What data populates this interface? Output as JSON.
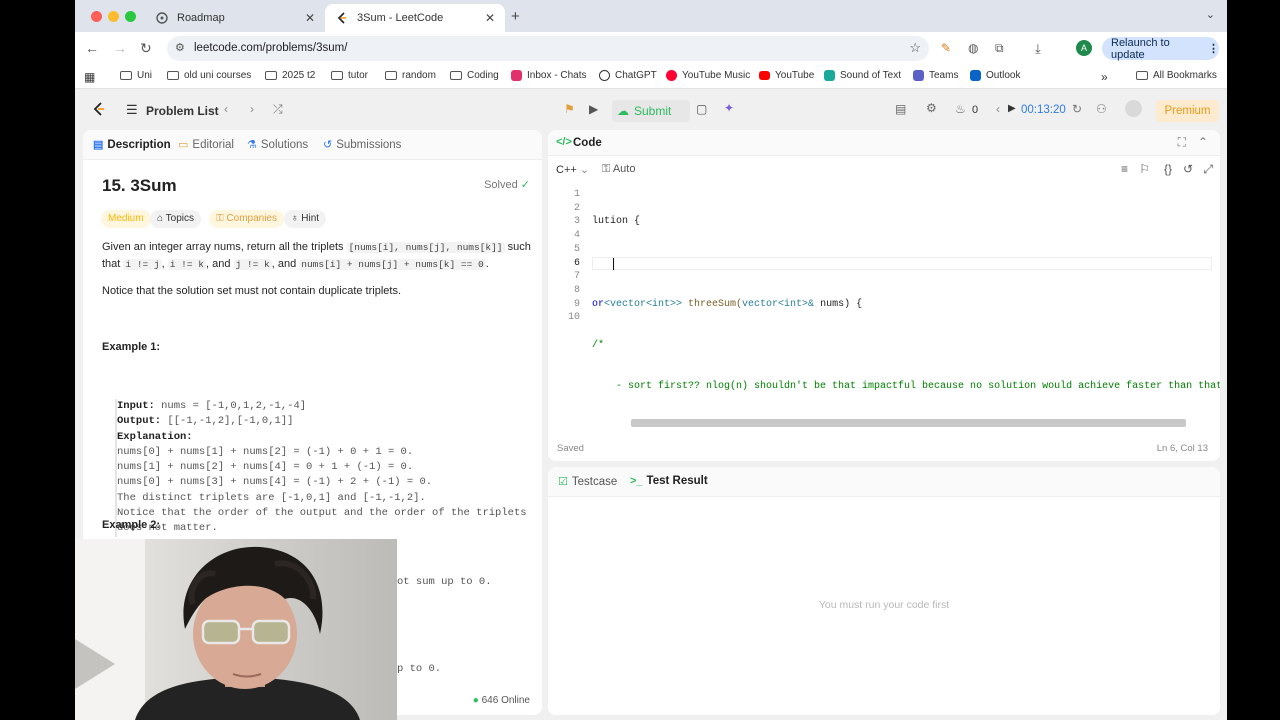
{
  "browser": {
    "tabs": [
      {
        "title": "Roadmap",
        "active": false
      },
      {
        "title": "3Sum - LeetCode",
        "active": true
      }
    ],
    "url": "leetcode.com/problems/3sum/",
    "relaunch_label": "Relaunch to update",
    "avatar_letter": "A",
    "bookmarks": [
      "Uni",
      "old uni courses",
      "2025 t2",
      "tutor",
      "random",
      "Coding",
      "Inbox - Chats",
      "ChatGPT",
      "YouTube Music",
      "YouTube",
      "Sound of Text",
      "Teams",
      "Outlook"
    ],
    "all_bookmarks": "All Bookmarks",
    "overflow": "»"
  },
  "header": {
    "problem_list": "Problem List",
    "submit": "Submit",
    "streak": "0",
    "timer": "00:13:20",
    "premium": "Premium"
  },
  "left": {
    "tabs": [
      "Description",
      "Editorial",
      "Solutions",
      "Submissions"
    ],
    "title": "15. 3Sum",
    "solved": "Solved",
    "chips": {
      "difficulty": "Medium",
      "topics": "Topics",
      "companies": "Companies",
      "hint": "Hint"
    },
    "desc1_a": "Given an integer array nums, return all the triplets",
    "desc1_c1": "[nums[i], nums[j], nums[k]]",
    "desc1_b": "such that",
    "desc1_c2": "i != j",
    "desc1_c3": "i != k",
    "desc1_and": ", and",
    "desc1_c4": "j != k",
    "desc1_and2": ", and",
    "desc1_c5": "nums[i] + nums[j] + nums[k] == 0",
    "desc2": "Notice that the solution set must not contain duplicate triplets.",
    "example1": "Example 1:",
    "ex1": {
      "input_label": "Input:",
      "input": "nums = [-1,0,1,2,-1,-4]",
      "output_label": "Output:",
      "output": "[[-1,-1,2],[-1,0,1]]",
      "explanation_label": "Explanation:",
      "lines": [
        "nums[0] + nums[1] + nums[2] = (-1) + 0 + 1 = 0.",
        "nums[1] + nums[2] + nums[4] = 0 + 1 + (-1) = 0.",
        "nums[0] + nums[3] + nums[4] = (-1) + 2 + (-1) = 0.",
        "The distinct triplets are [-1,0,1] and [-1,-1,2].",
        "Notice that the order of the output and the order of the triplets",
        "does not matter."
      ]
    },
    "example2": "Example 2:",
    "partial1": "ot sum up to 0.",
    "partial2": "p to 0.",
    "online": "646 Online"
  },
  "code": {
    "title": "Code",
    "language": "C++",
    "mode": "Auto",
    "line_numbers": [
      "1",
      "2",
      "3",
      "4",
      "5",
      "6",
      "7",
      "8",
      "9",
      "10"
    ],
    "line1": "lution {",
    "line3_a": "or",
    "line3_b": "<vector<int>>",
    "line3_c": " threeSum(",
    "line3_d": "vector<int>&",
    "line3_e": " nums) {",
    "line4": "/*",
    "line5": "    - sort first?? nlog(n) shouldn't be that impactful because no solution would achieve faster than that anyways",
    "line8": "*/",
    "saved": "Saved",
    "position": "Ln 6, Col 13"
  },
  "bottom": {
    "tabs": [
      "Testcase",
      "Test Result"
    ],
    "empty": "You must run your code first"
  }
}
